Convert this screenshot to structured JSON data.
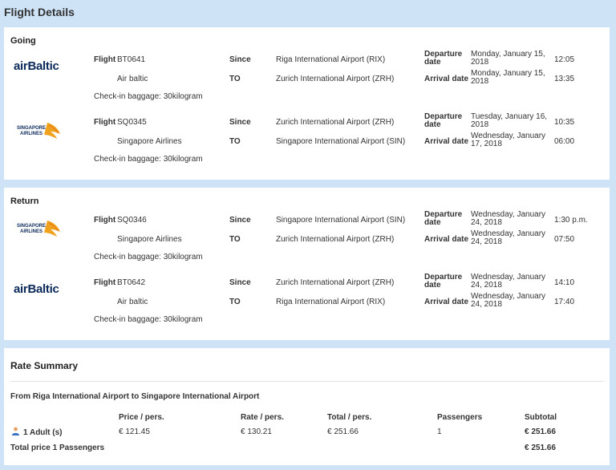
{
  "page": {
    "title": "Flight Details"
  },
  "going": {
    "title": "Going",
    "flights": [
      {
        "airline_logo": "airbaltic-logo",
        "logo_text": "airBaltic",
        "flight_label": "Flight",
        "flight_no": "BT0641",
        "airline": "Air baltic",
        "since_label": "Since",
        "from": "Riga International Airport (RIX)",
        "to_label": "TO",
        "to": "Zurich International Airport (ZRH)",
        "dep_label": "Departure date",
        "dep_date": "Monday, January 15, 2018",
        "dep_time": "12:05",
        "arr_label": "Arrival date",
        "arr_date": "Monday, January 15, 2018",
        "arr_time": "13:35",
        "baggage": "Check-in baggage: 30kilogram"
      },
      {
        "airline_logo": "singapore-airlines-logo",
        "logo_text": "SINGAPORE AIRLINES",
        "flight_label": "Flight",
        "flight_no": "SQ0345",
        "airline": "Singapore Airlines",
        "since_label": "Since",
        "from": "Zurich International Airport (ZRH)",
        "to_label": "TO",
        "to": "Singapore International Airport (SIN)",
        "dep_label": "Departure date",
        "dep_date": "Tuesday, January 16, 2018",
        "dep_time": "10:35",
        "arr_label": "Arrival date",
        "arr_date": "Wednesday, January 17, 2018",
        "arr_time": "06:00",
        "baggage": "Check-in baggage: 30kilogram"
      }
    ]
  },
  "return": {
    "title": "Return",
    "flights": [
      {
        "airline_logo": "singapore-airlines-logo",
        "logo_text": "SINGAPORE AIRLINES",
        "flight_label": "Flight",
        "flight_no": "SQ0346",
        "airline": "Singapore Airlines",
        "since_label": "Since",
        "from": "Singapore International Airport (SIN)",
        "to_label": "TO",
        "to": "Zurich International Airport (ZRH)",
        "dep_label": "Departure date",
        "dep_date": "Wednesday, January 24, 2018",
        "dep_time": "1:30 p.m.",
        "arr_label": "Arrival date",
        "arr_date": "Wednesday, January 24, 2018",
        "arr_time": "07:50",
        "baggage": "Check-in baggage: 30kilogram"
      },
      {
        "airline_logo": "airbaltic-logo",
        "logo_text": "airBaltic",
        "flight_label": "Flight",
        "flight_no": "BT0642",
        "airline": "Air baltic",
        "since_label": "Since",
        "from": "Zurich International Airport (ZRH)",
        "to_label": "TO",
        "to": "Riga International Airport (RIX)",
        "dep_label": "Departure date",
        "dep_date": "Wednesday, January 24, 2018",
        "dep_time": "14:10",
        "arr_label": "Arrival date",
        "arr_date": "Wednesday, January 24, 2018",
        "arr_time": "17:40",
        "baggage": "Check-in baggage: 30kilogram"
      }
    ]
  },
  "rate": {
    "title": "Rate Summary",
    "route": "From Riga International Airport to Singapore International Airport",
    "headers": {
      "price": "Price / pers.",
      "rate": "Rate / pers.",
      "total": "Total / pers.",
      "passengers": "Passengers",
      "subtotal": "Subtotal"
    },
    "row": {
      "icon": "person-icon",
      "label": "1 Adult (s)",
      "price": "€ 121.45",
      "rate": "€ 130.21",
      "total": "€ 251.66",
      "passengers": "1",
      "subtotal": "€ 251.66"
    },
    "total_label": "Total price 1 Passengers",
    "total_value": "€ 251.66"
  }
}
